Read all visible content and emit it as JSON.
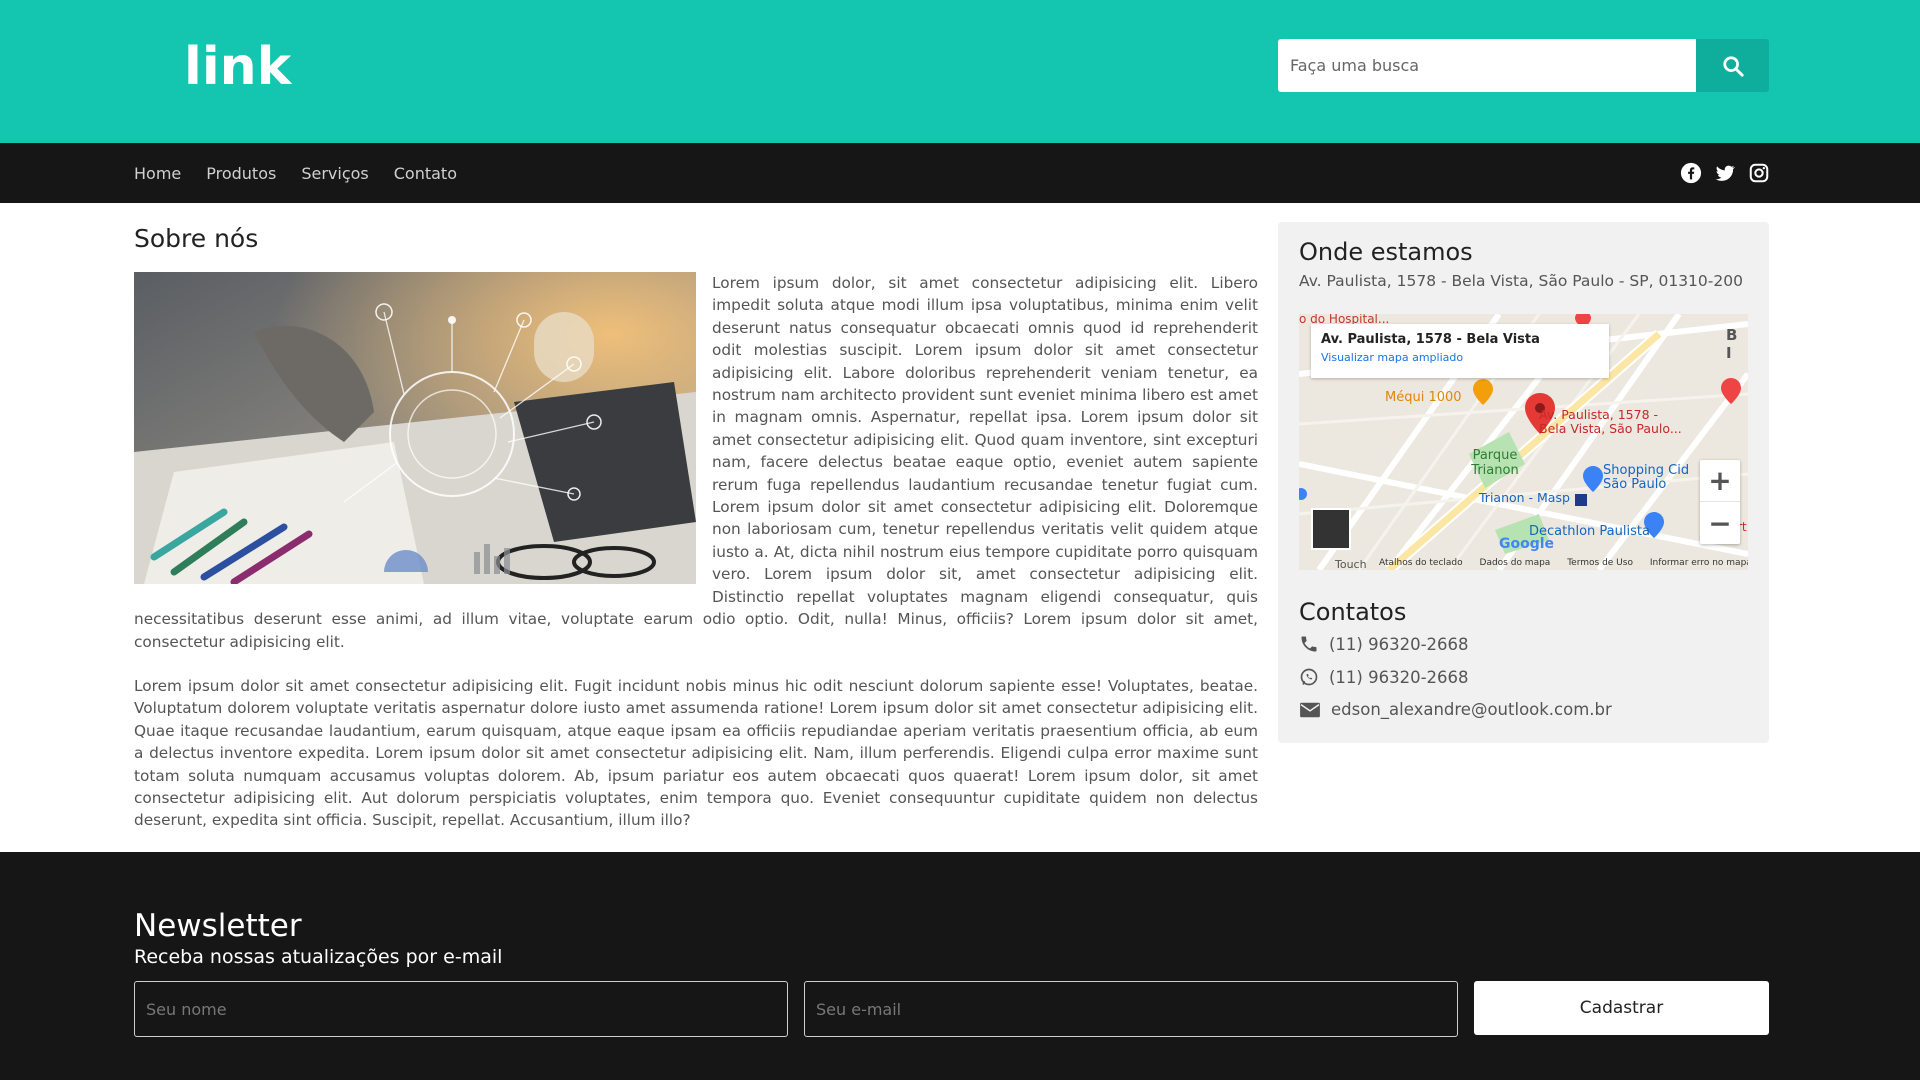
{
  "header": {
    "logo_text": "link",
    "search_placeholder": "Faça uma busca",
    "brand_color": "#14c5b0",
    "search_icon": "search-icon"
  },
  "nav": {
    "items": [
      {
        "label": "Home"
      },
      {
        "label": "Produtos"
      },
      {
        "label": "Serviços"
      },
      {
        "label": "Contato"
      }
    ],
    "social": [
      "facebook-icon",
      "twitter-icon",
      "instagram-icon"
    ]
  },
  "main": {
    "title": "Sobre nós",
    "paragraph1": "Lorem ipsum dolor, sit amet consectetur adipisicing elit. Libero impedit soluta atque modi illum ipsa voluptatibus, minima enim velit deserunt natus consequatur obcaecati omnis quod id reprehenderit odit molestias suscipit. Lorem ipsum dolor sit amet consectetur adipisicing elit. Labore doloribus reprehenderit veniam tenetur, ea nostrum nam architecto provident sunt eveniet minima libero est amet in magnam omnis. Aspernatur, repellat ipsa. Lorem ipsum dolor sit amet consectetur adipisicing elit. Quod quam inventore, sint excepturi nam, facere delectus beatae eaque optio, eveniet autem sapiente rerum fuga repellendus laudantium recusandae tenetur fugiat cum. Lorem ipsum dolor sit amet consectetur adipisicing elit. Doloremque non laboriosam cum, tenetur repellendus veritatis velit quidem atque iusto a. At, dicta nihil nostrum eius tempore cupiditate porro quisquam vero. Lorem ipsum dolor sit, amet consectetur adipisicing elit. Distinctio repellat voluptates magnam eligendi consequatur, quis necessitatibus deserunt esse animi, ad illum vitae, voluptate earum odio optio. Odit, nulla! Minus, officiis? Lorem ipsum dolor sit amet, consectetur adipisicing elit.",
    "paragraph2": "Lorem ipsum dolor sit amet consectetur adipisicing elit. Fugit incidunt nobis minus hic odit nesciunt dolorum sapiente esse! Voluptates, beatae. Voluptatum dolorem voluptate veritatis aspernatur dolore iusto amet assumenda ratione! Lorem ipsum dolor sit amet consectetur adipisicing elit. Quae itaque recusandae laudantium, earum quisquam, atque eaque ipsam ea officiis repudiandae aperiam veritatis praesentium officia, ab eum a delectus inventore expedita. Lorem ipsum dolor sit amet consectetur adipisicing elit. Nam, illum perferendis. Eligendi culpa error maxime sunt totam soluta numquam accusamus voluptas dolorem. Ab, ipsum pariatur eos autem obcaecati quos quaerat! Lorem ipsum dolor, sit amet consectetur adipisicing elit. Aut dolorum perspiciatis voluptates, enim tempora quo. Eveniet consequuntur cupiditate quidem non delectus deserunt, expedita sint officia. Suscipit, repellat. Accusantium, illum illo?"
  },
  "sidebar": {
    "location_title": "Onde estamos",
    "address": "Av. Paulista, 1578 - Bela Vista, São Paulo - SP, 01310-200",
    "map": {
      "card_title": "Av. Paulista, 1578 - Bela Vista",
      "card_link": "Visualizar mapa ampliado",
      "labels": {
        "hospital": "o do Hospital...",
        "mequi": "Méqui 1000",
        "pin": "Av. Paulista, 1578 - Bela Vista, São Paulo...",
        "parque": "Parque Trianon",
        "shopping": "Shopping Cid São Paulo",
        "trianon": "Trianon - Masp",
        "decathlon": "Decathlon Paulista",
        "google": "Google",
        "touch": "Touch",
        "bi": "B I",
        "rt": "rt"
      },
      "zoom_in": "+",
      "zoom_out": "−",
      "footer": [
        "Atalhos do teclado",
        "Dados do mapa",
        "Termos de Uso",
        "Informar erro no mapa"
      ]
    },
    "contacts_title": "Contatos",
    "contacts": [
      {
        "icon": "phone-icon",
        "text": "(11) 96320-2668"
      },
      {
        "icon": "whatsapp-icon",
        "text": "(11) 96320-2668"
      },
      {
        "icon": "envelope-icon",
        "text": "edson_alexandre@outlook.com.br"
      }
    ]
  },
  "footer": {
    "title": "Newsletter",
    "subtitle": "Receba nossas atualizações por e-mail",
    "name_placeholder": "Seu nome",
    "email_placeholder": "Seu e-mail",
    "button": "Cadastrar"
  }
}
